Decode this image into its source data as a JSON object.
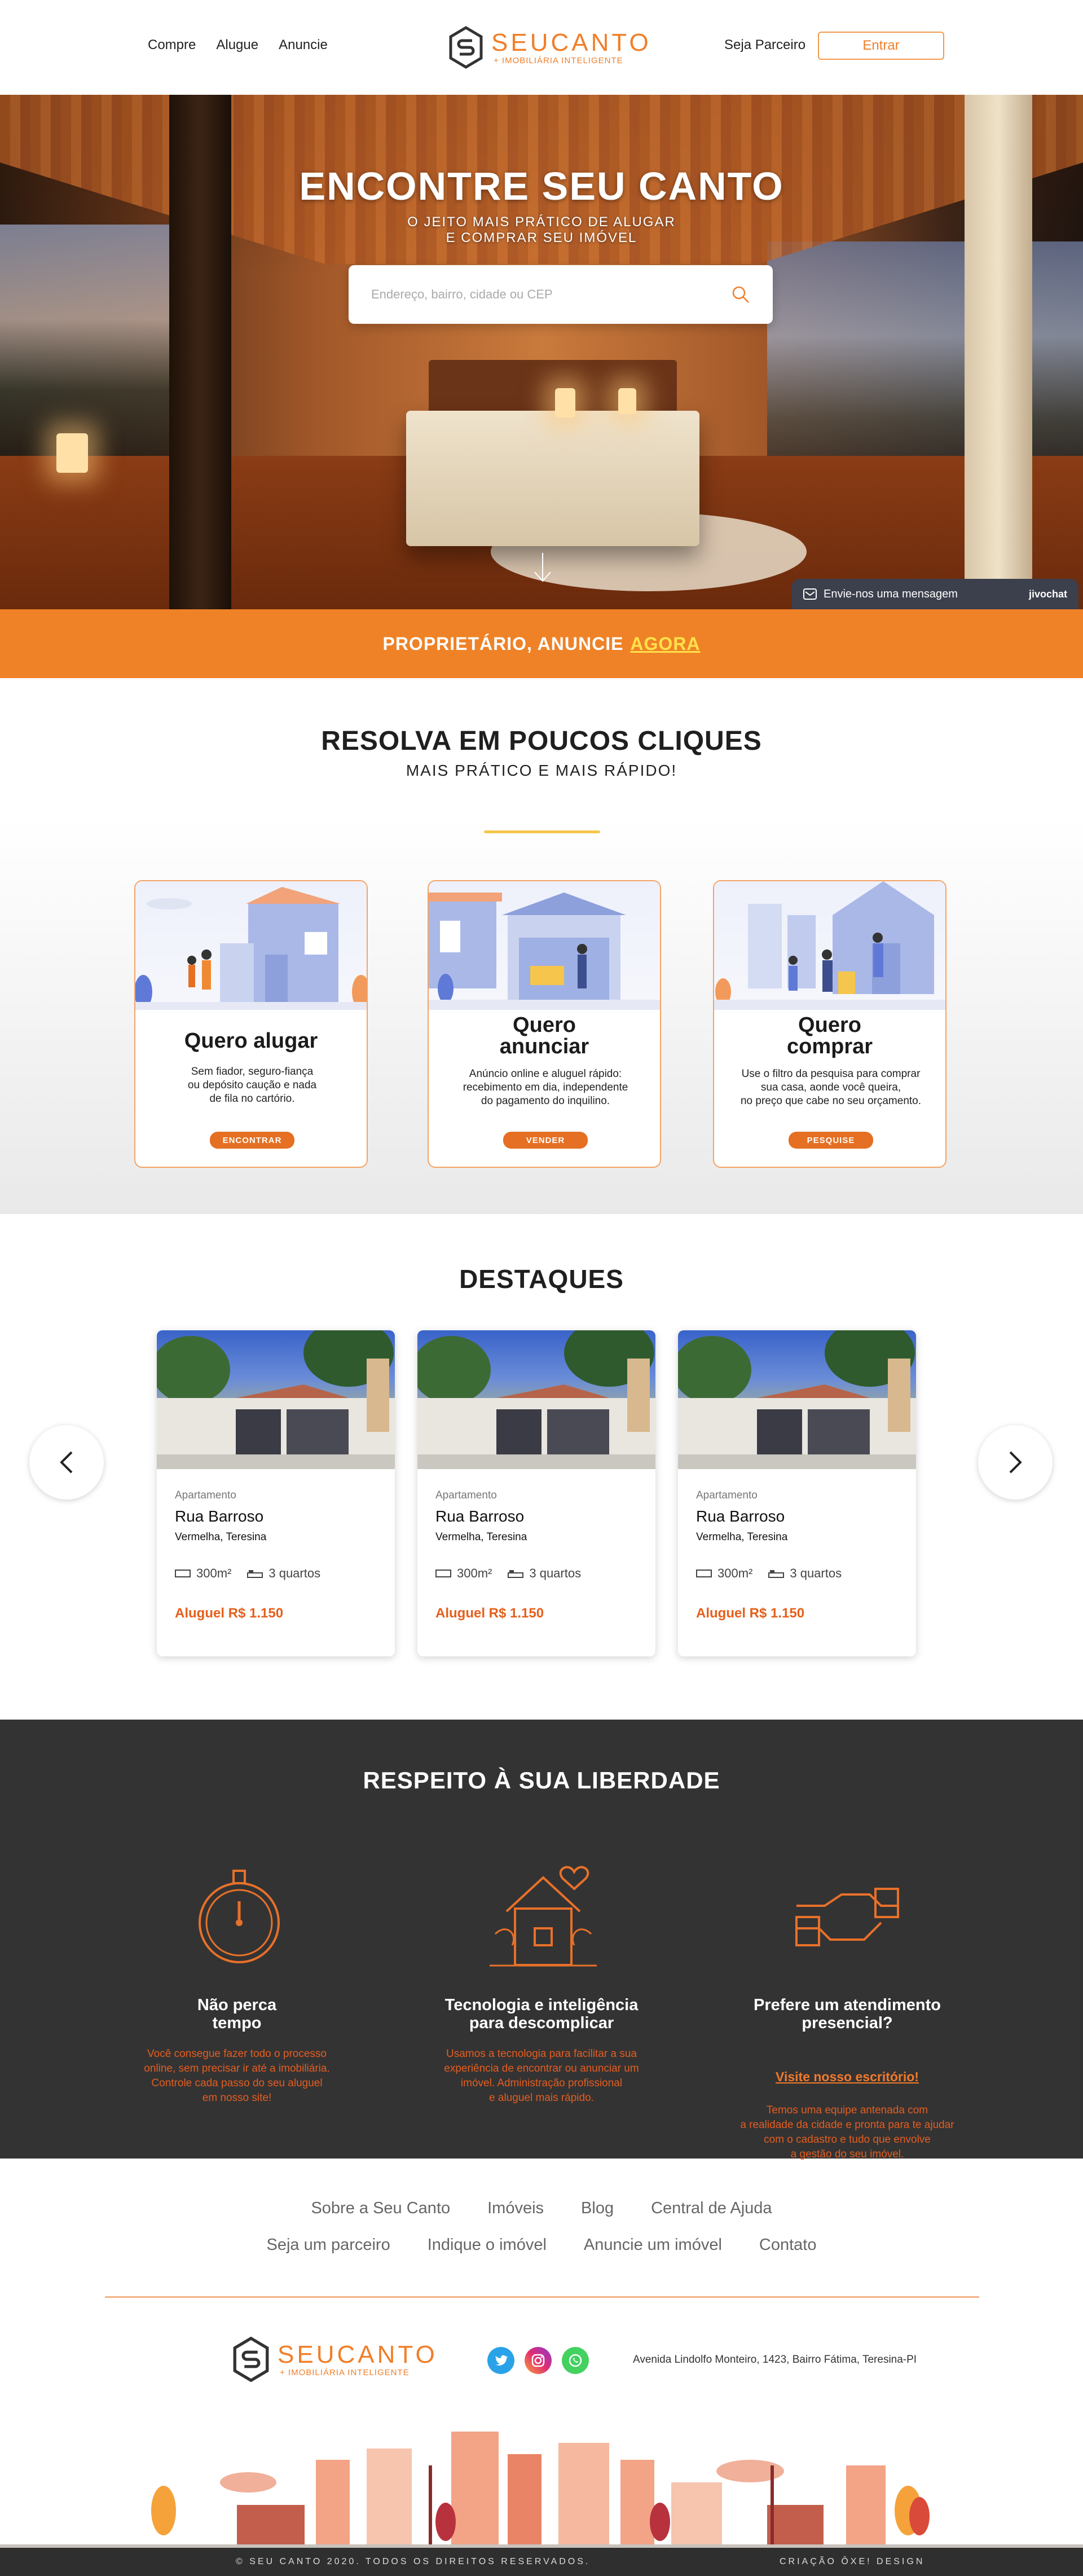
{
  "header": {
    "nav": [
      "Compre",
      "Alugue",
      "Anuncie"
    ],
    "logo_name": "SEUCANTO",
    "logo_sub": "+ IMOBILIÁRIA INTELIGENTE",
    "partner": "Seja Parceiro",
    "enter": "Entrar"
  },
  "hero": {
    "title": "ENCONTRE SEU CANTO",
    "sub1": "O JEITO MAIS PRÁTICO DE ALUGAR",
    "sub2": "E COMPRAR SEU IMÓVEL",
    "search_placeholder": "Endereço, bairro, cidade ou CEP",
    "chat_label": "Envie-nos uma mensagem",
    "chat_brand": "jivochat"
  },
  "band": {
    "text": "PROPRIETÁRIO, ANUNCIE",
    "highlight": "AGORA"
  },
  "resolva": {
    "title": "RESOLVA EM POUCOS CLIQUES",
    "sub": "MAIS PRÁTICO E MAIS RÁPIDO!",
    "cards": [
      {
        "title1": "Quero alugar",
        "title2": "",
        "text1": "Sem fiador, seguro-fiança",
        "text2": "ou depósito caução e nada",
        "text3": "de fila no cartório.",
        "button": "ENCONTRAR"
      },
      {
        "title1": "Quero",
        "title2": "anunciar",
        "text1": "Anúncio online e aluguel rápido:",
        "text2": "recebimento em dia, independente",
        "text3": "do pagamento do inquilino.",
        "button": "VENDER"
      },
      {
        "title1": "Quero",
        "title2": "comprar",
        "text1": "Use o filtro da pesquisa para comprar",
        "text2": "sua casa, aonde você queira,",
        "text3": "no preço que cabe no seu orçamento.",
        "button": "PESQUISE"
      }
    ]
  },
  "destaques": {
    "title": "DESTAQUES",
    "items": [
      {
        "type": "Apartamento",
        "street": "Rua Barroso",
        "hood": "Vermelha, Teresina",
        "area": "300m²",
        "rooms": "3 quartos",
        "price": "Aluguel R$ 1.150"
      },
      {
        "type": "Apartamento",
        "street": "Rua Barroso",
        "hood": "Vermelha, Teresina",
        "area": "300m²",
        "rooms": "3 quartos",
        "price": "Aluguel R$ 1.150"
      },
      {
        "type": "Apartamento",
        "street": "Rua Barroso",
        "hood": "Vermelha, Teresina",
        "area": "300m²",
        "rooms": "3 quartos",
        "price": "Aluguel R$ 1.150"
      }
    ]
  },
  "respeito": {
    "title": "RESPEITO À SUA LIBERDADE",
    "features": [
      {
        "h1": "Não perca",
        "h2": "tempo",
        "p": [
          "Você consegue fazer todo o processo",
          "online, sem precisar ir até a imobiliária.",
          "Controle cada passo do seu aluguel",
          "em nosso site!"
        ]
      },
      {
        "h1": "Tecnologia e inteligência",
        "h2": "para descomplicar",
        "p": [
          "Usamos a tecnologia para facilitar a sua",
          "experiência de encontrar ou anunciar um",
          "imóvel. Administração profissional",
          "e aluguel mais rápido."
        ]
      },
      {
        "h1": "Prefere um atendimento",
        "h2": "presencial?",
        "link": "Visite nosso escritório!",
        "p": [
          "Temos uma equipe antenada com",
          "a realidade da cidade e pronta para te ajudar",
          "com o cadastro e tudo que envolve",
          "a gestão do seu imóvel."
        ]
      }
    ]
  },
  "footer": {
    "row1": [
      "Sobre a Seu Canto",
      "Imóveis",
      "Blog",
      "Central de Ajuda"
    ],
    "row2": [
      "Seja um parceiro",
      "Indique o imóvel",
      "Anuncie um imóvel",
      "Contato"
    ],
    "address": "Avenida Lindolfo Monteiro, 1423, Bairro Fátima, Teresina-PI",
    "copyright": "© SEU CANTO 2020. TODOS OS DIREITOS RESERVADOS.",
    "credit": "CRIAÇÃO ÔXE! DESIGN"
  },
  "colors": {
    "accent": "#ef8227",
    "dark": "#343333",
    "yellow": "#ffe14b"
  }
}
